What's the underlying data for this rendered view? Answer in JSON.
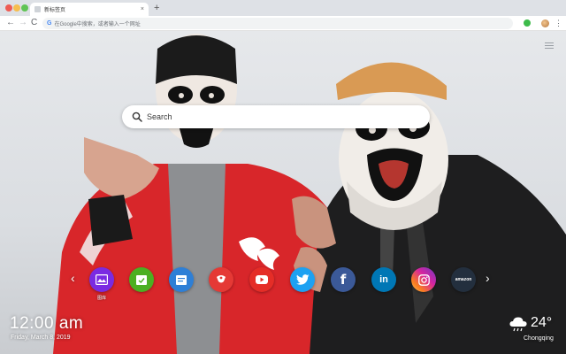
{
  "browser": {
    "tab": {
      "title": "新标签页",
      "close_icon": "×"
    },
    "new_tab_icon": "+",
    "nav": {
      "back": "←",
      "forward": "→",
      "reload": "C"
    },
    "omnibox": {
      "engine_icon": "G",
      "placeholder": "在Google中搜索，或者输入一个网址"
    },
    "extensions": [
      "green-circle-extension",
      "avatar-extension"
    ],
    "menu_icon": "⋮"
  },
  "page": {
    "search": {
      "placeholder": "Search"
    },
    "speed_dial": {
      "prev_icon": "‹",
      "next_icon": "›",
      "items": [
        {
          "label": "图库",
          "icon": "gallery-icon",
          "color": "#7a2be2"
        },
        {
          "label": "",
          "icon": "check-calendar-icon",
          "color": "#4caf22"
        },
        {
          "label": "",
          "icon": "notes-icon",
          "color": "#2e7fd6"
        },
        {
          "label": "",
          "icon": "game-icon",
          "color": "#e53935"
        },
        {
          "label": "",
          "icon": "youtube-icon",
          "color": "#e52d27"
        },
        {
          "label": "",
          "icon": "twitter-icon",
          "color": "#1da1f2"
        },
        {
          "label": "f",
          "icon": "facebook-icon",
          "color": "#3b5998"
        },
        {
          "label": "in",
          "icon": "linkedin-icon",
          "color": "#0077b5"
        },
        {
          "label": "",
          "icon": "instagram-icon",
          "color": "#d6249f"
        },
        {
          "label": "amazon",
          "icon": "amazon-icon",
          "color": "#232f3e"
        }
      ]
    },
    "clock": {
      "time": "12:00 am",
      "date": "Friday, March 8, 2019"
    },
    "weather": {
      "icon": "cloud-rain-icon",
      "temp": "24°",
      "city": "Chongqing"
    }
  }
}
